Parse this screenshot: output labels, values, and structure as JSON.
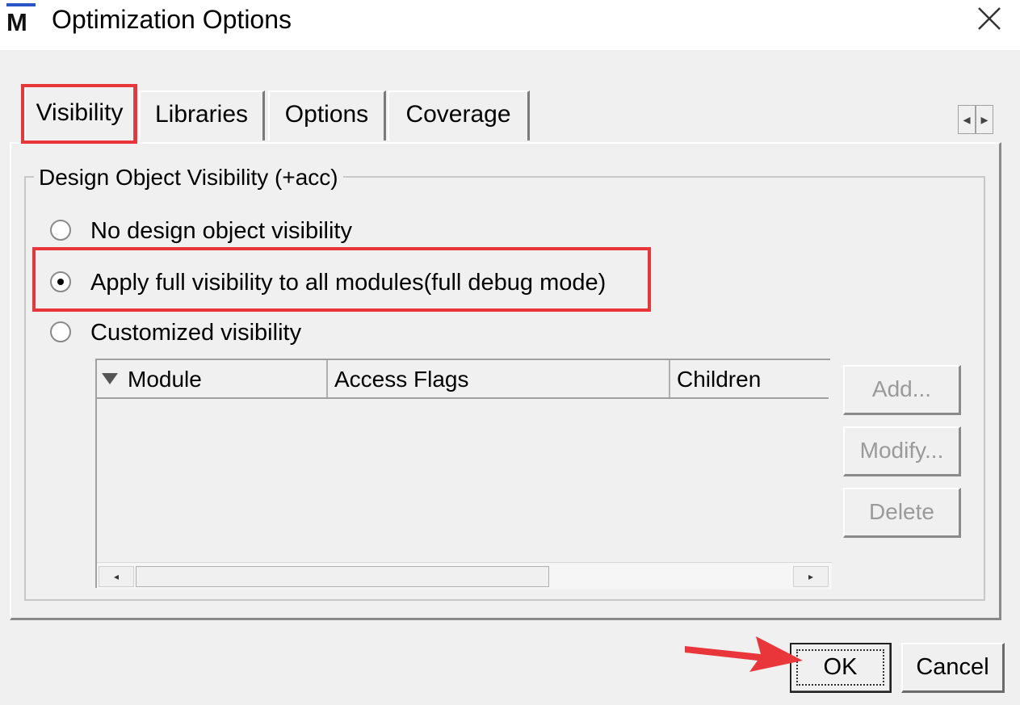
{
  "window": {
    "title": "Optimization Options",
    "logo_letter": "M",
    "close_glyph": "✕"
  },
  "tabs": [
    {
      "label": "Visibility",
      "active": true
    },
    {
      "label": "Libraries",
      "active": false
    },
    {
      "label": "Options",
      "active": false
    },
    {
      "label": "Coverage",
      "active": false
    }
  ],
  "tab_scroll": {
    "left": "◂",
    "right": "▸"
  },
  "visibility_group": {
    "title": "Design Object Visibility (+acc)",
    "options": [
      {
        "label": "No design object visibility",
        "selected": false
      },
      {
        "label": "Apply full visibility to all modules(full debug mode)",
        "selected": true
      },
      {
        "label": "Customized visibility",
        "selected": false
      }
    ]
  },
  "module_table": {
    "columns": [
      "Module",
      "Access Flags",
      "Children"
    ],
    "rows": [],
    "scroll_left": "◂",
    "scroll_right": "▸"
  },
  "side_buttons": {
    "add": "Add...",
    "modify": "Modify...",
    "delete": "Delete"
  },
  "dialog_buttons": {
    "ok": "OK",
    "cancel": "Cancel"
  },
  "annotations": {
    "highlight_color": "#e8363a",
    "arrow_color": "#e8363a"
  },
  "icons": [
    "close-icon",
    "app-logo-icon",
    "sort-icon",
    "arrow-annotation"
  ]
}
